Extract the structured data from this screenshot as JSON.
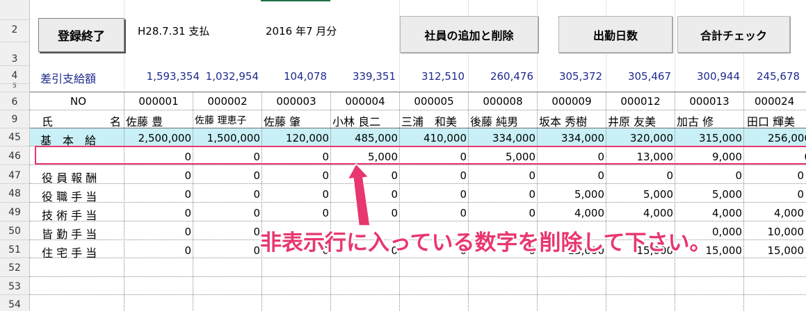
{
  "buttons": {
    "register_end": "登録終了",
    "add_delete_employee": "社員の追加と削除",
    "attendance_days": "出勤日数",
    "total_check": "合計チェック"
  },
  "header": {
    "payment_date": "H28.7.31 支払",
    "month": "2016 年7 月分"
  },
  "row_numbers": [
    "2",
    "3",
    "4",
    "5",
    "6",
    "9",
    "45",
    "46",
    "47",
    "48",
    "49",
    "50",
    "51",
    "52",
    "53",
    "54"
  ],
  "net_pay": {
    "label": "差引支給額",
    "values": [
      "1,593,354",
      "1,032,954",
      "104,078",
      "339,351",
      "312,510",
      "260,476",
      "305,372",
      "305,467",
      "300,944",
      "245,678"
    ]
  },
  "employees": {
    "no_label": "NO",
    "name_label_a": "氏",
    "name_label_b": "名",
    "ids": [
      "000001",
      "000002",
      "000003",
      "000004",
      "000005",
      "000008",
      "000009",
      "000012",
      "000013",
      "000024"
    ],
    "names": [
      "佐藤 豊",
      "佐藤 理恵子",
      "佐藤 肇",
      "小林 良二",
      "三浦　和美",
      "後藤 純男",
      "坂本 秀樹",
      "井原 友美",
      "加古 修",
      "田口 輝美"
    ]
  },
  "rows": {
    "basic": {
      "label": "基　本　給",
      "values": [
        "2,500,000",
        "1,500,000",
        "120,000",
        "485,000",
        "410,000",
        "334,000",
        "334,000",
        "320,000",
        "315,000",
        "256,000"
      ]
    },
    "hidden": {
      "label": "",
      "values": [
        "0",
        "0",
        "0",
        "5,000",
        "0",
        "5,000",
        "0",
        "13,000",
        "9,000",
        "0"
      ]
    },
    "officer": {
      "label": "役 員 報 酬",
      "values": [
        "0",
        "0",
        "0",
        "0",
        "0",
        "0",
        "0",
        "0",
        "0",
        "0"
      ]
    },
    "position": {
      "label": "役 職 手 当",
      "values": [
        "0",
        "0",
        "0",
        "0",
        "0",
        "0",
        "5,000",
        "5,000",
        "5,000",
        "0"
      ]
    },
    "technical": {
      "label": "技 術 手 当",
      "values": [
        "0",
        "0",
        "0",
        "0",
        "0",
        "0",
        "4,000",
        "4,000",
        "4,000",
        "4,000"
      ]
    },
    "attendance": {
      "label": "皆 勤 手 当",
      "values": [
        "0",
        "0",
        "",
        "",
        "",
        "",
        "",
        "",
        "0,000",
        "10,000"
      ]
    },
    "housing": {
      "label": "住 宅 手 当",
      "values": [
        "0",
        "0",
        "0",
        "0",
        "0",
        "0",
        "15,000",
        "15,000",
        "15,000",
        "15,000"
      ]
    }
  },
  "annotation": "非表示行に入っている数字を削除して下さい。",
  "colors": {
    "accent": "#e8366e",
    "header_blue": "#1f2a8c",
    "band": "#c8f0f6"
  }
}
